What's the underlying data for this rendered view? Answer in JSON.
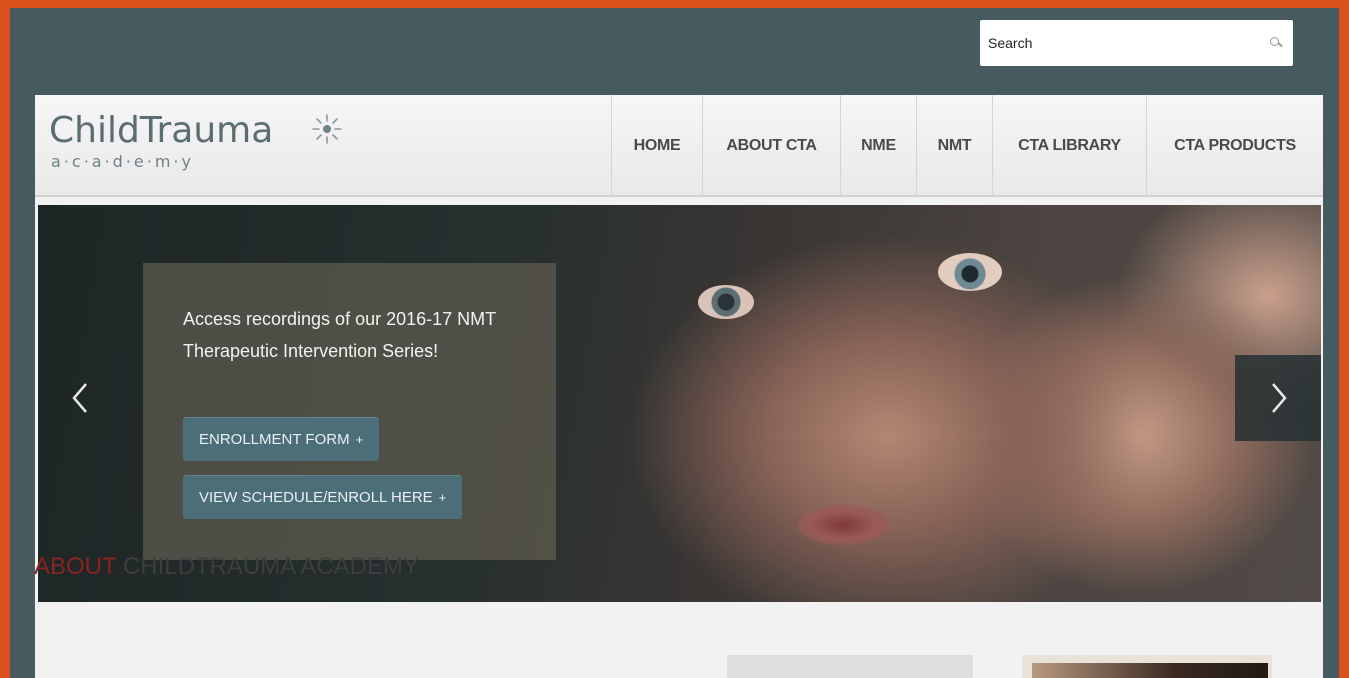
{
  "search": {
    "placeholder": "Search",
    "icon": "search-icon"
  },
  "logo": {
    "main": "ChildTrauma",
    "sub": "a·c·a·d·e·m·y"
  },
  "nav": {
    "items": [
      {
        "label": "HOME"
      },
      {
        "label": "ABOUT CTA"
      },
      {
        "label": "NME"
      },
      {
        "label": "NMT"
      },
      {
        "label": "CTA LIBRARY"
      },
      {
        "label": "CTA PRODUCTS"
      }
    ]
  },
  "hero": {
    "caption": "Access recordings of our 2016-17 NMT Therapeutic Intervention Series!",
    "buttons": [
      {
        "label": "ENROLLMENT FORM",
        "icon": "+"
      },
      {
        "label": "VIEW SCHEDULE/ENROLL HERE",
        "icon": "+"
      }
    ],
    "prev_icon": "chevron-left-icon",
    "next_icon": "chevron-right-icon"
  },
  "about": {
    "accent": "ABOUT",
    "rest": " CHILDTRAUMA ACADEMY"
  },
  "colors": {
    "frame": "#465a5f",
    "outer": "#d9521e",
    "accent_red": "#8b2323",
    "button": "#4c6e78"
  }
}
